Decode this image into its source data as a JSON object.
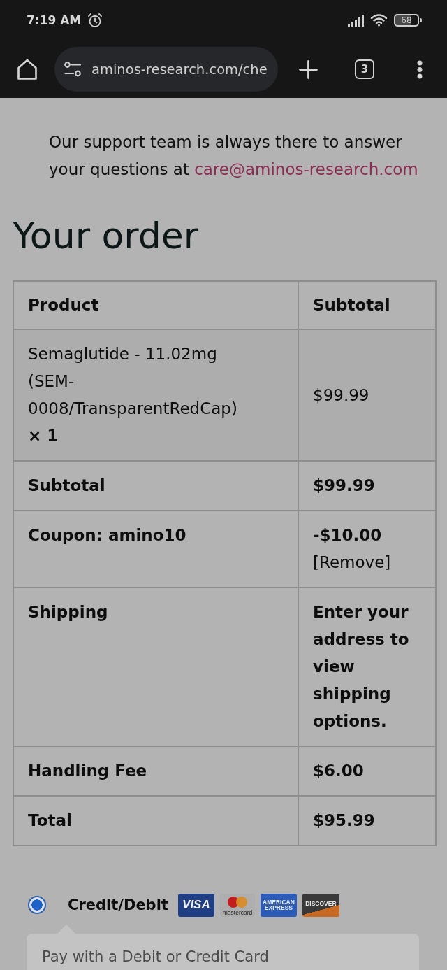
{
  "status_bar": {
    "time": "7:19 AM",
    "battery": "68"
  },
  "browser": {
    "url": "aminos-research.com/che",
    "tab_count": "3"
  },
  "support_note": {
    "text": "Our support team is always there to answer your questions at",
    "email": "care@aminos-research.com"
  },
  "order": {
    "title": "Your order",
    "columns": [
      "Product",
      "Subtotal"
    ],
    "rows": [
      {
        "kind": "item",
        "name": "Semaglutide - 11.02mg (SEM-0008/TransparentRedCap)",
        "quantity": "× 1",
        "amount": "$99.99"
      },
      {
        "kind": "total",
        "label": "Subtotal",
        "value": "$99.99"
      },
      {
        "kind": "coupon",
        "label": "Coupon: amino10",
        "value": "-$10.00",
        "action": "[Remove]"
      },
      {
        "kind": "total",
        "label": "Shipping",
        "value": "Enter your address to view shipping options."
      },
      {
        "kind": "total",
        "label": "Handling Fee",
        "value": "$6.00"
      },
      {
        "kind": "total",
        "label": "Total",
        "value": "$95.99"
      }
    ]
  },
  "payment": {
    "methods": [
      {
        "label": "Credit/Debit",
        "selected": true,
        "cards": [
          {
            "kind": "visa",
            "label": "VISA"
          },
          {
            "kind": "mastercard",
            "label": "mastercard"
          },
          {
            "kind": "amex",
            "label": "AMERICAN EXPRESS"
          },
          {
            "kind": "discover",
            "label": "DISCOVER"
          }
        ]
      }
    ],
    "description": "Pay with a Debit or Credit Card"
  }
}
